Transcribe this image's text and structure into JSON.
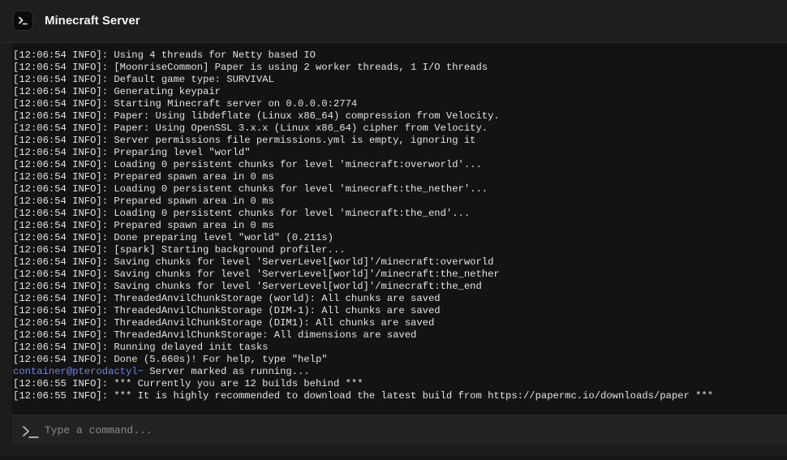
{
  "header": {
    "title": "Minecraft Server",
    "icon": "terminal-icon"
  },
  "console": {
    "lines": [
      {
        "text": "[12:06:54 INFO]: Using 4 threads for Netty based IO"
      },
      {
        "text": "[12:06:54 INFO]: [MoonriseCommon] Paper is using 2 worker threads, 1 I/O threads"
      },
      {
        "text": "[12:06:54 INFO]: Default game type: SURVIVAL"
      },
      {
        "text": "[12:06:54 INFO]: Generating keypair"
      },
      {
        "text": "[12:06:54 INFO]: Starting Minecraft server on 0.0.0.0:2774"
      },
      {
        "text": "[12:06:54 INFO]: Paper: Using libdeflate (Linux x86_64) compression from Velocity."
      },
      {
        "text": "[12:06:54 INFO]: Paper: Using OpenSSL 3.x.x (Linux x86_64) cipher from Velocity."
      },
      {
        "text": "[12:06:54 INFO]: Server permissions file permissions.yml is empty, ignoring it"
      },
      {
        "text": "[12:06:54 INFO]: Preparing level \"world\""
      },
      {
        "text": "[12:06:54 INFO]: Loading 0 persistent chunks for level 'minecraft:overworld'..."
      },
      {
        "text": "[12:06:54 INFO]: Prepared spawn area in 0 ms"
      },
      {
        "text": "[12:06:54 INFO]: Loading 0 persistent chunks for level 'minecraft:the_nether'..."
      },
      {
        "text": "[12:06:54 INFO]: Prepared spawn area in 0 ms"
      },
      {
        "text": "[12:06:54 INFO]: Loading 0 persistent chunks for level 'minecraft:the_end'..."
      },
      {
        "text": "[12:06:54 INFO]: Prepared spawn area in 0 ms"
      },
      {
        "text": "[12:06:54 INFO]: Done preparing level \"world\" (0.211s)"
      },
      {
        "text": "[12:06:54 INFO]: [spark] Starting background profiler..."
      },
      {
        "text": "[12:06:54 INFO]: Saving chunks for level 'ServerLevel[world]'/minecraft:overworld"
      },
      {
        "text": "[12:06:54 INFO]: Saving chunks for level 'ServerLevel[world]'/minecraft:the_nether"
      },
      {
        "text": "[12:06:54 INFO]: Saving chunks for level 'ServerLevel[world]'/minecraft:the_end"
      },
      {
        "text": "[12:06:54 INFO]: ThreadedAnvilChunkStorage (world): All chunks are saved"
      },
      {
        "text": "[12:06:54 INFO]: ThreadedAnvilChunkStorage (DIM-1): All chunks are saved"
      },
      {
        "text": "[12:06:54 INFO]: ThreadedAnvilChunkStorage (DIM1): All chunks are saved"
      },
      {
        "text": "[12:06:54 INFO]: ThreadedAnvilChunkStorage: All dimensions are saved"
      },
      {
        "text": "[12:06:54 INFO]: Running delayed init tasks"
      },
      {
        "text": "[12:06:54 INFO]: Done (5.660s)! For help, type \"help\""
      },
      {
        "prefix": "container@pterodactyl~",
        "text": " Server marked as running..."
      },
      {
        "text": "[12:06:55 INFO]: *** Currently you are 12 builds behind ***"
      },
      {
        "text": "[12:06:55 INFO]: *** It is highly recommended to download the latest build from https://papermc.io/downloads/paper ***"
      }
    ]
  },
  "command": {
    "placeholder": "Type a command...",
    "value": "",
    "icon": "terminal-prompt-icon"
  },
  "colors": {
    "background": "#1c1c1c",
    "console_background": "#131313",
    "log_text": "#e3e3e3",
    "prompt_prefix": "#6f86d6",
    "placeholder": "#8a8a8a"
  }
}
